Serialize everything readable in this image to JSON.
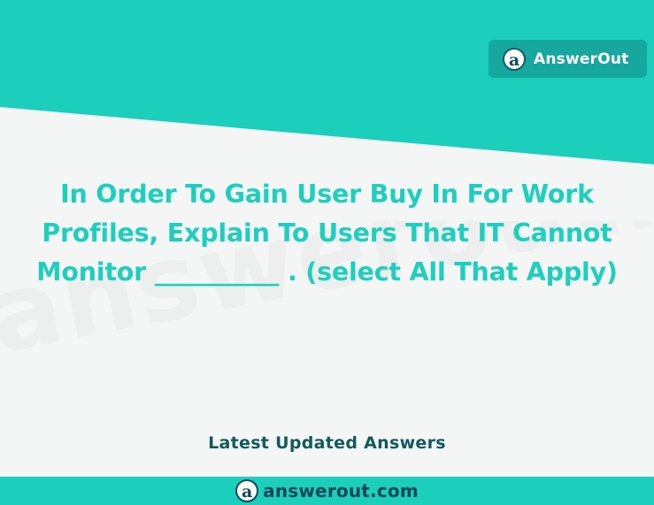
{
  "colors": {
    "accent": "#1ccfbd",
    "badge_bg": "#16a79e",
    "question_text": "#1fcfbd",
    "dark_text": "#135a5a",
    "background": "#f4f5f5"
  },
  "badge": {
    "logo_letter": "a",
    "text": "AnswerOut"
  },
  "watermark": "answerout.com",
  "question": {
    "text": "In Order To Gain User Buy In For Work Profiles, Explain To Users That IT Cannot Monitor __________ . (select All That Apply)"
  },
  "subtitle": "Latest Updated Answers",
  "footer": {
    "logo_letter": "a",
    "domain": "answerout.com"
  }
}
